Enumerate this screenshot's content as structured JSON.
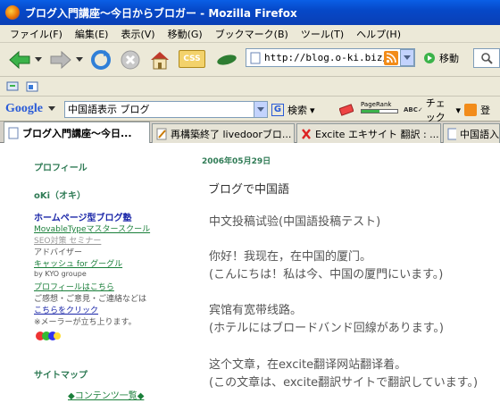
{
  "window": {
    "title": "ブログ入門講座～今日からブロガー - Mozilla Firefox"
  },
  "menu": [
    "ファイル(F)",
    "編集(E)",
    "表示(V)",
    "移動(G)",
    "ブックマーク(B)",
    "ツール(T)",
    "ヘルプ(H)"
  ],
  "toolbar": {
    "url": "http://blog.o-ki.biz/",
    "go_label": "移動",
    "css_label": "CSS"
  },
  "google_bar": {
    "logo": "Google",
    "query": "中国語表示 ブログ",
    "search_label": "検索",
    "pagerank_label": "PageRank",
    "spell_label": "チェック",
    "extra_label": "登"
  },
  "tabs": [
    {
      "label": "ブログ入門講座～今日..."
    },
    {
      "label": "再構築終了 livedoorブロ..."
    },
    {
      "label": "Excite エキサイト 翻訳 : ..."
    },
    {
      "label": "中国語入"
    }
  ],
  "sidebar": {
    "profile_heading": "プロフィール",
    "name": "oKi（オキ）",
    "homepage_label": "ホームページ型ブログ塾",
    "mt_school": "MovableTypeマスタースクール",
    "seo_seminar": "SEO対策 セミナー",
    "adviser": "アドバイザー",
    "cashflow": "キャッシュ for グーグル",
    "by_kyo": "by KYO groupe",
    "profile_link": "プロフィールはこちら",
    "contact_text": "ご感想・ご意見・ご連絡などは",
    "click_link": "こちらをクリック",
    "mailer_note": "※メーラーが立ち上ります。",
    "sitemap_heading": "サイトマップ",
    "contents_link": "◆コンテンツ一覧◆"
  },
  "entry": {
    "date": "2006年05月29日",
    "title": "ブログで中国語",
    "lines": [
      "中文投稿试验(中国語投稿テスト)",
      "你好！我现在，在中国的厦门。",
      "(こんにちは！私は今、中国の厦門にいます。)",
      "宾馆有宽带线路。",
      "(ホテルにはブロードバンド回線があります。)",
      "这个文章，在excite翻译网站翻译着。",
      "(この文章は、excite翻訳サイトで翻訳しています。)"
    ]
  }
}
